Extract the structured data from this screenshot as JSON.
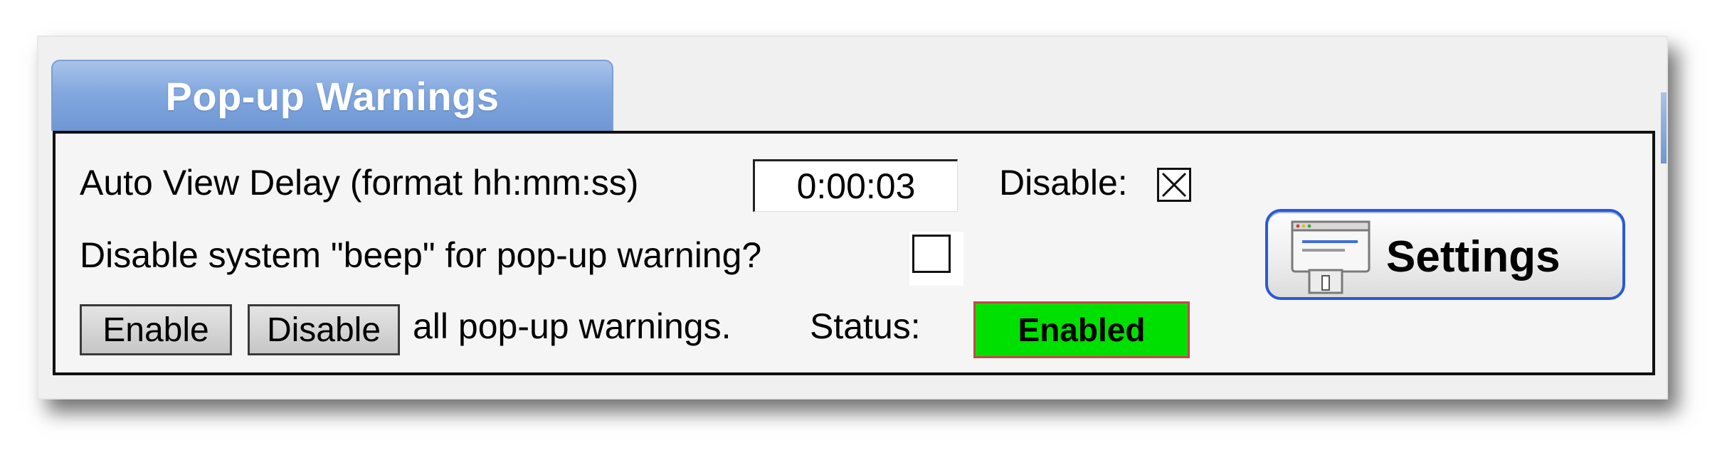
{
  "tab": {
    "title": "Pop-up Warnings"
  },
  "delay": {
    "label": "Auto View Delay (format hh:mm:ss)",
    "value": "0:00:03",
    "disable_label": "Disable:",
    "disable_checked": true
  },
  "beep": {
    "label": "Disable system \"beep\" for pop-up warning?",
    "checked": false
  },
  "actions": {
    "enable_label": "Enable",
    "disable_label": "Disable",
    "suffix_text": "all pop-up warnings.",
    "status_label": "Status:",
    "status_value": "Enabled"
  },
  "settings": {
    "label": "Settings",
    "icon": "settings-window-icon"
  },
  "colors": {
    "tab_blue": "#83a8df",
    "status_green": "#00e000",
    "status_border": "#c54848",
    "settings_border": "#2b59d6"
  }
}
